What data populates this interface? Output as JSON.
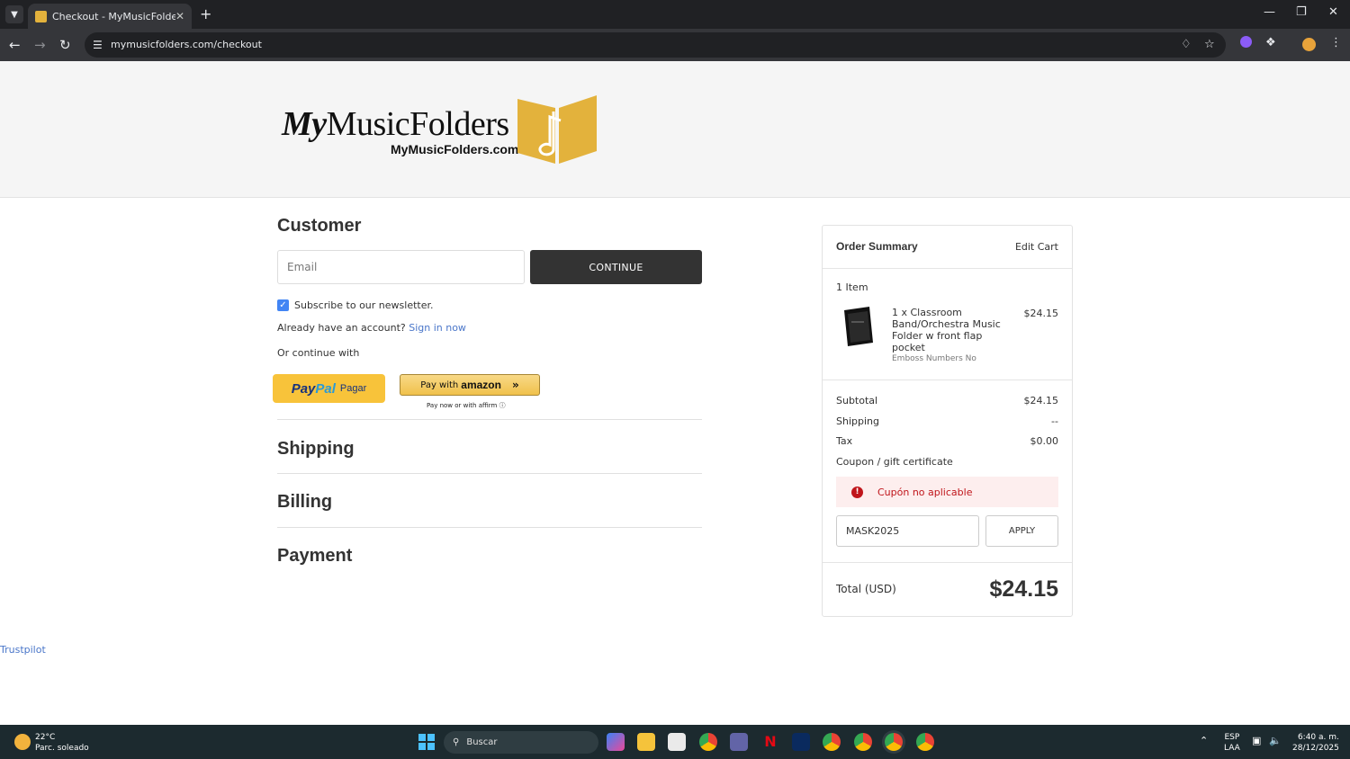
{
  "browser": {
    "tab_title": "Checkout - MyMusicFolders",
    "url": "mymusicfolders.com/checkout"
  },
  "header": {
    "logo_word_italic": "My",
    "logo_word": "MusicFolders",
    "logo_sub": "MyMusicFolders.com"
  },
  "customer": {
    "title": "Customer",
    "email_placeholder": "Email",
    "continue_label": "CONTINUE",
    "newsletter_label": "Subscribe to our newsletter.",
    "account_text": "Already have an account?",
    "sign_in_label": "Sign in now",
    "or_continue": "Or continue with",
    "paypal_word_a": "Pay",
    "paypal_word_b": "Pal",
    "paypal_pagar": "Pagar",
    "amazon_prefix": "Pay with",
    "amazon_brand": "amazon",
    "affirm_text": "Pay now or with affirm"
  },
  "sections": {
    "shipping": "Shipping",
    "billing": "Billing",
    "payment": "Payment"
  },
  "footer": {
    "trustpilot": "Trustpilot"
  },
  "summary": {
    "title": "Order Summary",
    "edit_cart": "Edit Cart",
    "item_count": "1 Item",
    "item_name_1": "1 x Classroom",
    "item_name_2": "Band/Orchestra Music",
    "item_name_3": "Folder w front flap",
    "item_name_4": "pocket",
    "item_option": "Emboss Numbers No",
    "item_price": "$24.15",
    "subtotal_label": "Subtotal",
    "subtotal_value": "$24.15",
    "shipping_label": "Shipping",
    "shipping_value": "--",
    "tax_label": "Tax",
    "tax_value": "$0.00",
    "coupon_link": "Coupon / gift certificate",
    "error_text": "Cupón no aplicable",
    "coupon_value": "MASK2025",
    "apply_label": "APPLY",
    "total_label": "Total (USD)",
    "total_value": "$24.15"
  },
  "taskbar": {
    "weather_temp": "22°C",
    "weather_desc": "Parc. soleado",
    "search_label": "Buscar",
    "lang_1": "ESP",
    "lang_2": "LAA",
    "time": "6:40 a. m.",
    "date": "28/12/2025"
  },
  "colors": {
    "accent_link": "#4a76c9",
    "dark_button": "#333333",
    "error": "#c0151b",
    "paypal_yellow": "#f8c33a",
    "logo_gold": "#e3b23c"
  }
}
